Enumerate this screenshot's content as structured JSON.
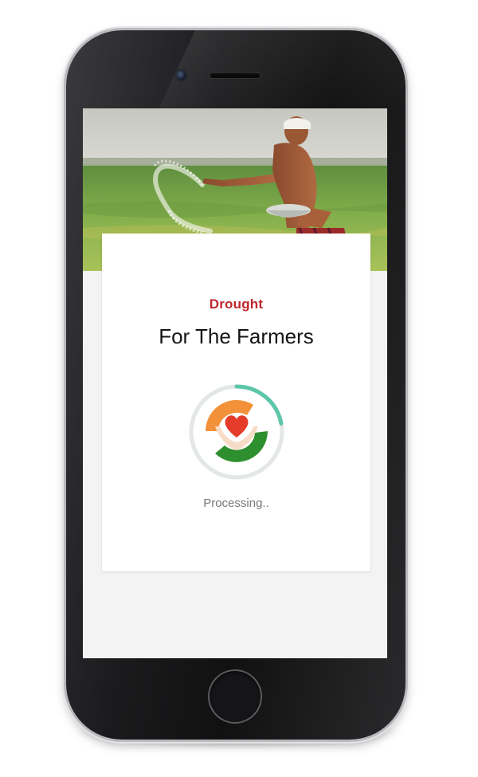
{
  "app": {
    "category": "Drought",
    "title": "For The Farmers",
    "status": "Processing.."
  },
  "loader": {
    "progress": 0.22,
    "track_color": "#e3e7e6",
    "progress_color": "#5cc6a8"
  },
  "logo": {
    "top_color": "#f3913a",
    "bottom_color": "#2e8f2f",
    "heart_color": "#e53b2a",
    "hands_color": "#f7ddc8"
  },
  "theme": {
    "category_color": "#c0272d",
    "screen_background": "#f3f3f3",
    "card_background": "#ffffff"
  }
}
